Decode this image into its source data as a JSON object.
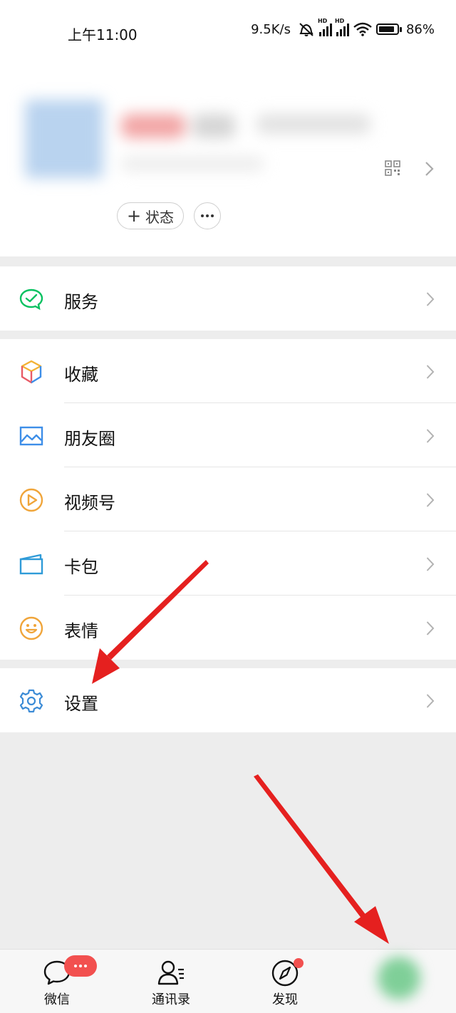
{
  "status_bar": {
    "time": "上午11:00",
    "net_speed": "9.5K/s",
    "sim1_tag": "HD",
    "sim2_tag": "HD",
    "battery": "86%",
    "battery_level": 0.86
  },
  "profile": {
    "status_label": "状态",
    "status_plus": "+"
  },
  "menu": {
    "services": {
      "label": "服务",
      "icon": "wechat-pay-icon"
    },
    "favorites": {
      "label": "收藏",
      "icon": "cube-icon"
    },
    "moments": {
      "label": "朋友圈",
      "icon": "picture-icon"
    },
    "channels": {
      "label": "视频号",
      "icon": "play-icon"
    },
    "cards": {
      "label": "卡包",
      "icon": "wallet-icon"
    },
    "stickers": {
      "label": "表情",
      "icon": "smiley-icon"
    },
    "settings": {
      "label": "设置",
      "icon": "gear-icon"
    }
  },
  "bottom_nav": {
    "tabs": [
      {
        "label": "微信",
        "icon": "chat-icon"
      },
      {
        "label": "通讯录",
        "icon": "contacts-icon"
      },
      {
        "label": "发现",
        "icon": "compass-icon"
      },
      {
        "label": "",
        "icon": "me-icon"
      }
    ]
  },
  "colors": {
    "green": "#07c160",
    "arrow_red": "#e5201f",
    "badge_red": "#f2504f"
  }
}
